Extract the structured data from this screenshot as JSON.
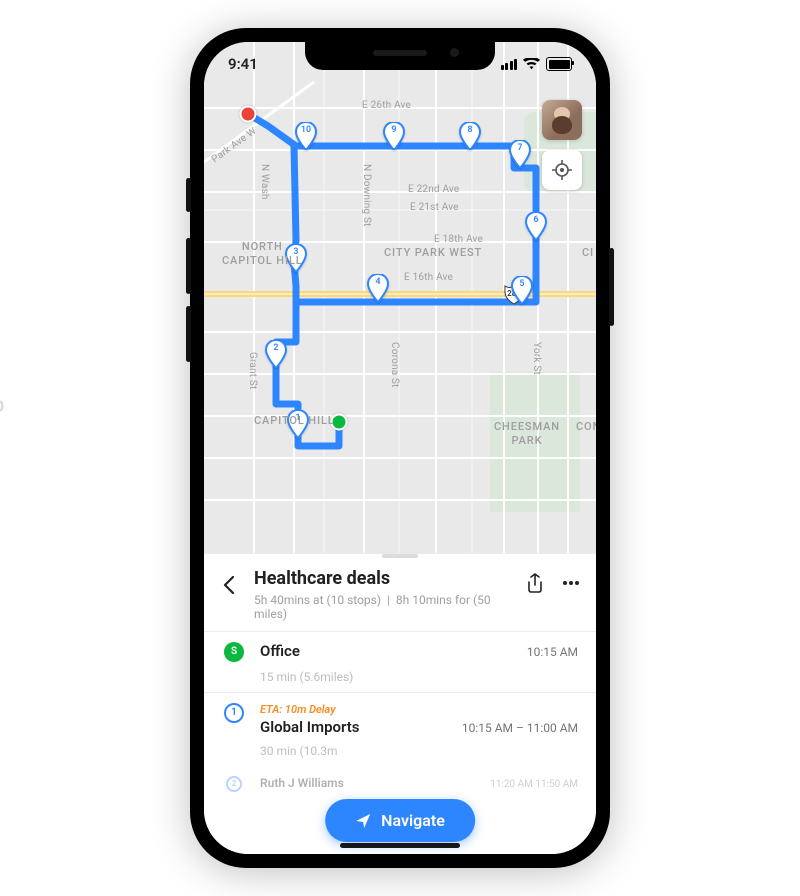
{
  "status_bar": {
    "time": "9:41"
  },
  "map": {
    "areas": {
      "north_capitol_hill": "NORTH\nCAPITOL HILL",
      "capitol_hill": "CAPITOL HILL",
      "city_park_west": "CITY PARK WEST",
      "cheesman_park": "CHEESMAN\nPARK",
      "con_edge": "CON",
      "ci_edge": "CI"
    },
    "streets": {
      "park_ave_w": "Park Ave W",
      "n_wash": "N Wash",
      "n_downing": "N Downing St",
      "e26": "E 26th Ave",
      "e22": "E 22nd Ave",
      "e21": "E 21st Ave",
      "e18": "E 18th Ave",
      "e16": "E 16th Ave",
      "grant": "Grant St",
      "corona": "Corona St",
      "york": "York St"
    },
    "highway_shield": "287",
    "pins": [
      "1",
      "2",
      "3",
      "4",
      "5",
      "6",
      "7",
      "8",
      "9",
      "10"
    ],
    "controls": {
      "avatar_name": "user-avatar",
      "locate_name": "locate-me"
    }
  },
  "sheet": {
    "title": "Healthcare deals",
    "summary": {
      "duration": "5h 40mins at",
      "stops": "(10 stops)",
      "sep": "|",
      "travel": "8h 10mins for",
      "miles": "(50 miles)"
    },
    "stops": [
      {
        "badge": "S",
        "kind": "start",
        "name": "Office",
        "time": "10:15 AM",
        "seg": "15 min (5.6miles)"
      },
      {
        "badge": "1",
        "kind": "num",
        "eta": "ETA: 10m Delay",
        "name": "Global Imports",
        "time": "10:15 AM – 11:00 AM",
        "seg": "30 min (10.3m"
      },
      {
        "badge": "2",
        "kind": "num",
        "name": "Ruth J Williams",
        "time": "11:20 AM  11:50 AM"
      }
    ],
    "navigate_label": "Navigate"
  }
}
